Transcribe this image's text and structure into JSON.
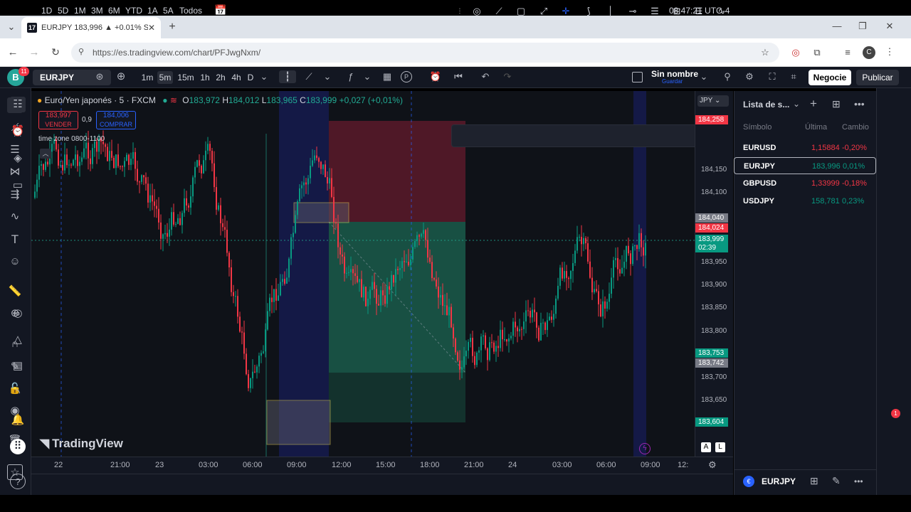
{
  "browser": {
    "tab_title": "EURJPY 183,996 ▲ +0.01% Sin",
    "url": "https://es.tradingview.com/chart/PFJwgNxm/"
  },
  "toolbar": {
    "avatar_letter": "B",
    "avatar_badge": "11",
    "symbol": "EURJPY",
    "intervals": [
      "1m",
      "5m",
      "15m",
      "1h",
      "2h",
      "4h",
      "D"
    ],
    "active_interval": "5m",
    "layout_name": "Sin nombre",
    "layout_sub": "Guardar",
    "trade_button": "Negocie",
    "publish_button": "Publicar"
  },
  "legend": {
    "title": "Euro/Yen japonés · 5 · FXCM",
    "open_label": "O",
    "open": "183,972",
    "high_label": "H",
    "high": "184,012",
    "low_label": "L",
    "low": "183,965",
    "close_label": "C",
    "close": "183,999",
    "change": "+0,027 (+0,01%)",
    "sell_price": "183,997",
    "sell_label": "VENDER",
    "spread": "0,9",
    "buy_price": "184,006",
    "buy_label": "COMPRAR",
    "indicator": "time zone 0800-1100"
  },
  "price_axis": {
    "currency": "JPY",
    "ticks": [
      "184,150",
      "184,100",
      "184,050",
      "183,950",
      "183,900",
      "183,850",
      "183,800",
      "183,700",
      "183,650"
    ],
    "tags": [
      {
        "text": "184,258",
        "color": "#f23645"
      },
      {
        "text": "184,040",
        "color": "#787b86"
      },
      {
        "text": "184,024",
        "color": "#f23645"
      },
      {
        "text": "183,999",
        "color": "#089981"
      },
      {
        "text": "02:39",
        "color": "#089981"
      },
      {
        "text": "183,753",
        "color": "#089981"
      },
      {
        "text": "183,742",
        "color": "#787b86"
      },
      {
        "text": "183,604",
        "color": "#089981"
      }
    ]
  },
  "time_axis": {
    "ticks": [
      "22",
      "21:00",
      "23",
      "03:00",
      "06:00",
      "09:00",
      "12:00",
      "15:00",
      "18:00",
      "21:00",
      "24",
      "03:00",
      "06:00",
      "09:00",
      "12:"
    ]
  },
  "bottom_bar": {
    "ranges": [
      "1D",
      "5D",
      "1M",
      "3M",
      "6M",
      "YTD",
      "1A",
      "5A",
      "Todos"
    ],
    "clock": "08:47:21 UTC-4"
  },
  "watermark": "TradingView",
  "axis_buttons": [
    "A",
    "L"
  ],
  "watchlist": {
    "title": "Lista de s...",
    "col_symbol": "Símbolo",
    "col_last": "Última",
    "col_change": "Cambio",
    "rows": [
      {
        "symbol": "EURUSD",
        "last": "1,15884",
        "change": "-0,20%",
        "up": false
      },
      {
        "symbol": "EURJPY",
        "last": "183,996",
        "change": "0,01%",
        "up": true
      },
      {
        "symbol": "GBPUSD",
        "last": "1,33999",
        "change": "-0,18%",
        "up": false
      },
      {
        "symbol": "USDJPY",
        "last": "158,781",
        "change": "0,23%",
        "up": true
      }
    ],
    "footer_symbol": "EURJPY"
  },
  "alerts_badge": "1",
  "colors": {
    "up": "#089981",
    "down": "#f23645",
    "accent": "#2962ff"
  }
}
